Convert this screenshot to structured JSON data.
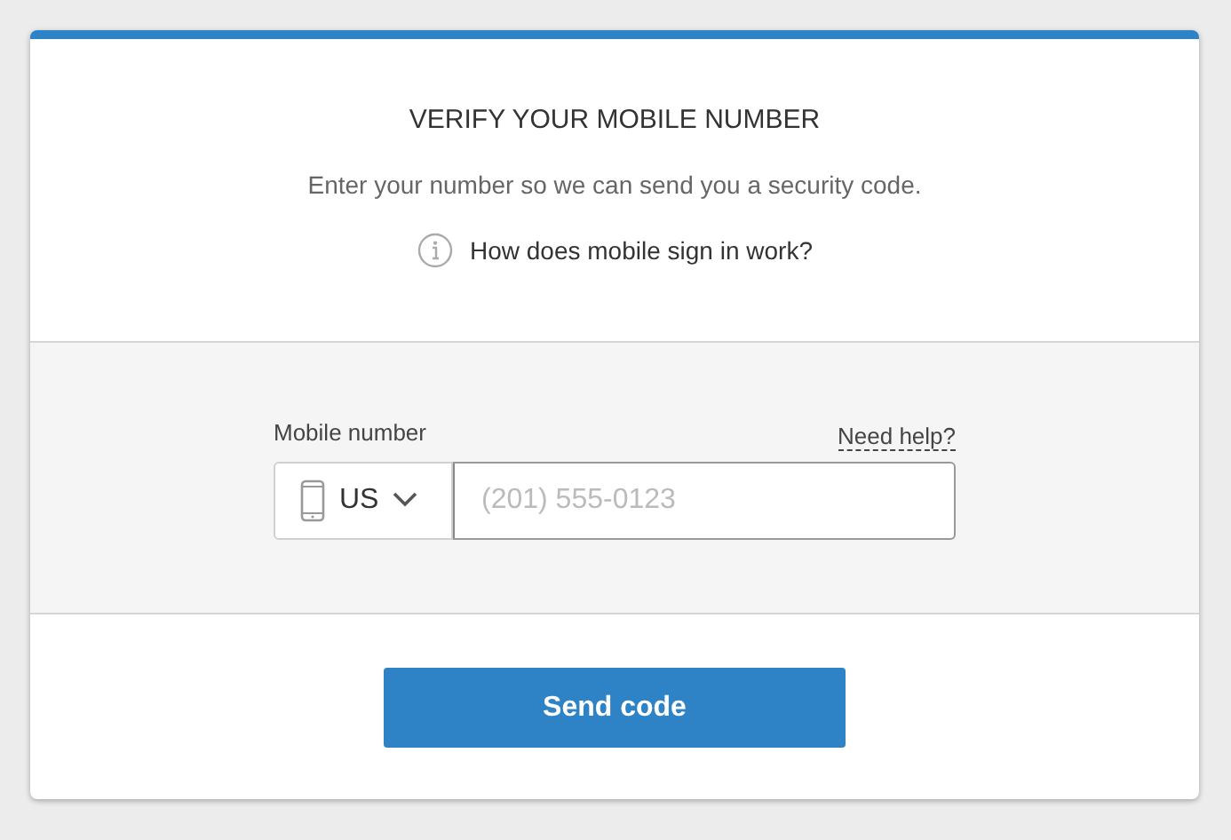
{
  "title": "VERIFY YOUR MOBILE NUMBER",
  "subtitle": "Enter your number so we can send you a security code.",
  "info_link": "How does mobile sign in work?",
  "phone": {
    "label": "Mobile number",
    "help_link": "Need help?",
    "country": "US",
    "placeholder": "(201) 555-0123"
  },
  "submit": "Send code"
}
